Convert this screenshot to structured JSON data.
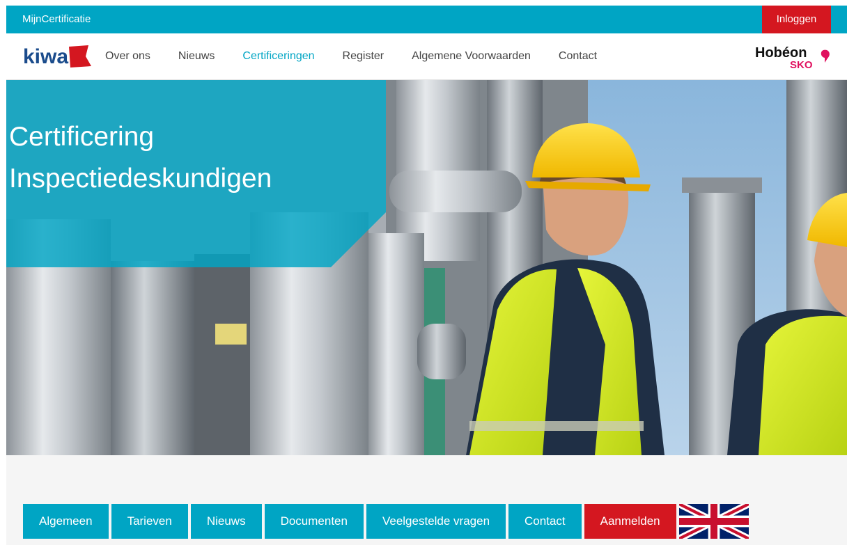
{
  "topbar": {
    "brand": "MijnCertificatie",
    "login_label": "Inloggen"
  },
  "navbar": {
    "logo_text": "kiwa",
    "items": [
      {
        "label": "Over ons"
      },
      {
        "label": "Nieuws"
      },
      {
        "label": "Certificeringen",
        "active": true
      },
      {
        "label": "Register"
      },
      {
        "label": "Algemene Voorwaarden"
      },
      {
        "label": "Contact"
      }
    ],
    "partner_logo": {
      "line1": "Hobéon",
      "line2": "SKO"
    }
  },
  "hero": {
    "title_line1": "Certificering",
    "title_line2": "Inspectiedeskundigen"
  },
  "tabs": [
    {
      "label": "Algemeen"
    },
    {
      "label": "Tarieven"
    },
    {
      "label": "Nieuws"
    },
    {
      "label": "Documenten"
    },
    {
      "label": "Veelgestelde vragen"
    },
    {
      "label": "Contact"
    },
    {
      "label": "Aanmelden",
      "style": "red"
    }
  ],
  "language_flag": "uk-flag-icon",
  "colors": {
    "accent": "#00a5c4",
    "danger": "#d41720",
    "nav_text": "#444444"
  }
}
